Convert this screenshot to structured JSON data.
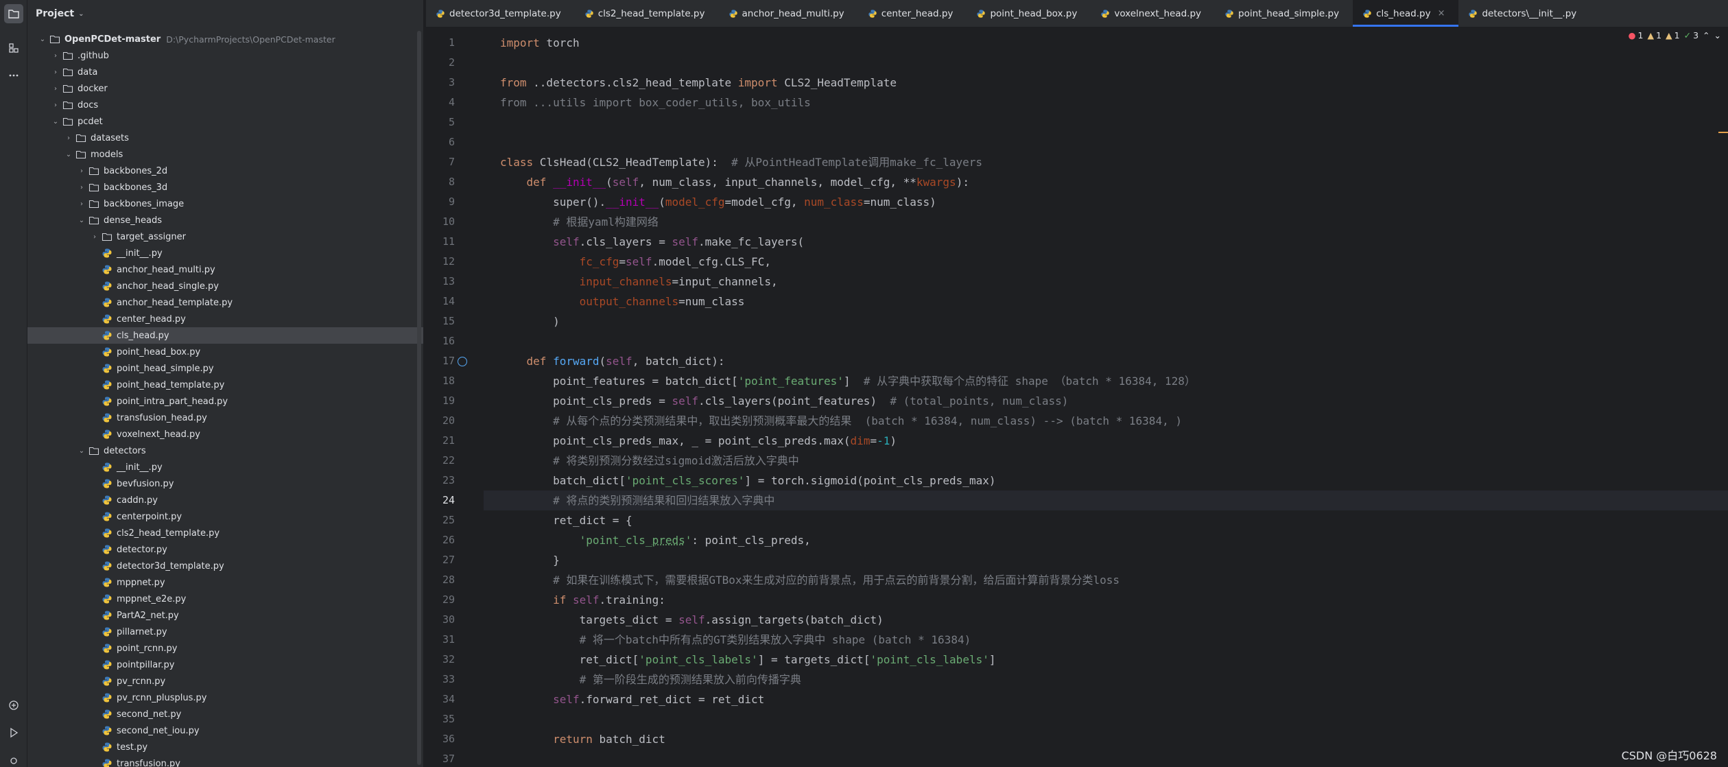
{
  "project": {
    "title": "Project",
    "root_name": "OpenPCDet-master",
    "root_path": "D:\\PycharmProjects\\OpenPCDet-master",
    "tree": [
      {
        "label": ".github",
        "type": "folder",
        "depth": 1,
        "state": "closed"
      },
      {
        "label": "data",
        "type": "folder",
        "depth": 1,
        "state": "closed"
      },
      {
        "label": "docker",
        "type": "folder",
        "depth": 1,
        "state": "closed"
      },
      {
        "label": "docs",
        "type": "folder",
        "depth": 1,
        "state": "closed"
      },
      {
        "label": "pcdet",
        "type": "folder",
        "depth": 1,
        "state": "open"
      },
      {
        "label": "datasets",
        "type": "folder",
        "depth": 2,
        "state": "closed"
      },
      {
        "label": "models",
        "type": "folder",
        "depth": 2,
        "state": "open"
      },
      {
        "label": "backbones_2d",
        "type": "folder",
        "depth": 3,
        "state": "closed"
      },
      {
        "label": "backbones_3d",
        "type": "folder",
        "depth": 3,
        "state": "closed"
      },
      {
        "label": "backbones_image",
        "type": "folder",
        "depth": 3,
        "state": "closed"
      },
      {
        "label": "dense_heads",
        "type": "folder",
        "depth": 3,
        "state": "open"
      },
      {
        "label": "target_assigner",
        "type": "folder",
        "depth": 4,
        "state": "closed"
      },
      {
        "label": "__init__.py",
        "type": "py",
        "depth": 4
      },
      {
        "label": "anchor_head_multi.py",
        "type": "py",
        "depth": 4
      },
      {
        "label": "anchor_head_single.py",
        "type": "py",
        "depth": 4
      },
      {
        "label": "anchor_head_template.py",
        "type": "py",
        "depth": 4
      },
      {
        "label": "center_head.py",
        "type": "py",
        "depth": 4
      },
      {
        "label": "cls_head.py",
        "type": "py",
        "depth": 4,
        "selected": true
      },
      {
        "label": "point_head_box.py",
        "type": "py",
        "depth": 4
      },
      {
        "label": "point_head_simple.py",
        "type": "py",
        "depth": 4
      },
      {
        "label": "point_head_template.py",
        "type": "py",
        "depth": 4
      },
      {
        "label": "point_intra_part_head.py",
        "type": "py",
        "depth": 4
      },
      {
        "label": "transfusion_head.py",
        "type": "py",
        "depth": 4
      },
      {
        "label": "voxelnext_head.py",
        "type": "py",
        "depth": 4
      },
      {
        "label": "detectors",
        "type": "folder",
        "depth": 3,
        "state": "open"
      },
      {
        "label": "__init__.py",
        "type": "py",
        "depth": 4
      },
      {
        "label": "bevfusion.py",
        "type": "py",
        "depth": 4
      },
      {
        "label": "caddn.py",
        "type": "py",
        "depth": 4
      },
      {
        "label": "centerpoint.py",
        "type": "py",
        "depth": 4
      },
      {
        "label": "cls2_head_template.py",
        "type": "py",
        "depth": 4
      },
      {
        "label": "detector.py",
        "type": "py",
        "depth": 4
      },
      {
        "label": "detector3d_template.py",
        "type": "py",
        "depth": 4
      },
      {
        "label": "mppnet.py",
        "type": "py",
        "depth": 4
      },
      {
        "label": "mppnet_e2e.py",
        "type": "py",
        "depth": 4
      },
      {
        "label": "PartA2_net.py",
        "type": "py",
        "depth": 4
      },
      {
        "label": "pillarnet.py",
        "type": "py",
        "depth": 4
      },
      {
        "label": "point_rcnn.py",
        "type": "py",
        "depth": 4
      },
      {
        "label": "pointpillar.py",
        "type": "py",
        "depth": 4
      },
      {
        "label": "pv_rcnn.py",
        "type": "py",
        "depth": 4
      },
      {
        "label": "pv_rcnn_plusplus.py",
        "type": "py",
        "depth": 4
      },
      {
        "label": "second_net.py",
        "type": "py",
        "depth": 4
      },
      {
        "label": "second_net_iou.py",
        "type": "py",
        "depth": 4
      },
      {
        "label": "test.py",
        "type": "py",
        "depth": 4
      },
      {
        "label": "transfusion.py",
        "type": "py",
        "depth": 4
      }
    ]
  },
  "tabs": [
    {
      "label": "detector3d_template.py"
    },
    {
      "label": "cls2_head_template.py"
    },
    {
      "label": "anchor_head_multi.py"
    },
    {
      "label": "center_head.py"
    },
    {
      "label": "point_head_box.py"
    },
    {
      "label": "voxelnext_head.py"
    },
    {
      "label": "point_head_simple.py"
    },
    {
      "label": "cls_head.py",
      "active": true
    },
    {
      "label": "detectors\\__init__.py"
    }
  ],
  "inspections": {
    "errors": "1",
    "warnings": "1",
    "weak_warnings": "1",
    "ok": "3"
  },
  "editor": {
    "current_line": 24,
    "lines": [
      "<span class=\"kw\">import</span> torch",
      "",
      "<span class=\"kw\">from</span> ..detectors.cls2_head_template <span class=\"kw\">import</span> CLS2_HeadTemplate",
      "<span class=\"dim\">from ...utils import box_coder_utils, box_utils</span>",
      "",
      "",
      "<span class=\"kw\">class</span> ClsHead(CLS2_HeadTemplate):  <span class=\"cmt\"># 从PointHeadTemplate调用make_fc_layers</span>",
      "    <span class=\"kw\">def</span> <span class=\"dund\">__init__</span>(<span class=\"self\">self</span>, num_class, input_channels, model_cfg, **<span class=\"param\">kwargs</span>):",
      "        super().<span class=\"dund\">__init__</span>(<span class=\"param\">model_cfg</span>=model_cfg, <span class=\"param\">num_class</span>=num_class)",
      "        <span class=\"cmt\"># 根据yaml构建网络</span>",
      "        <span class=\"self\">self</span>.cls_layers = <span class=\"self\">self</span>.make_fc_layers(",
      "            <span class=\"param\">fc_cfg</span>=<span class=\"self\">self</span>.model_cfg.CLS_FC,",
      "            <span class=\"param\">input_channels</span>=input_channels,",
      "            <span class=\"param\">output_channels</span>=num_class",
      "        )",
      "",
      "    <span class=\"kw\">def</span> <span class=\"fn\">forward</span>(<span class=\"self\">self</span>, batch_dict):",
      "        point_features = batch_dict[<span class=\"str\">'point_features'</span>]  <span class=\"cmt\"># 从字典中获取每个点的特征 shape （batch * 16384, 128）</span>",
      "        point_cls_preds = <span class=\"self\">self</span>.cls_layers(point_features)  <span class=\"cmt\"># (total_points, num_class)</span>",
      "        <span class=\"cmt\"># 从每个点的分类预测结果中，取出类别预测概率最大的结果  (batch * 16384, num_class) --> (batch * 16384, )</span>",
      "        point_cls_preds_max, _ = point_cls_preds.max(<span class=\"param\">dim</span>=<span class=\"num\">-1</span>)",
      "        <span class=\"cmt\"># 将类别预测分数经过sigmoid激活后放入字典中</span>",
      "        batch_dict[<span class=\"str\">'point_cls_scores'</span>] = torch.sigmoid(point_cls_preds_max)",
      "        <span class=\"cmt\"># 将点的类别预测结果和回归结果放入字典中</span>",
      "        ret_dict = {",
      "            <span class=\"str\">'point_cls_<span class=\"und\">preds</span>'</span>: point_cls_preds,",
      "        }",
      "        <span class=\"cmt\"># 如果在训练模式下，需要根据GTBox来生成对应的前背景点，用于点云的前背景分割，给后面计算前背景分类loss</span>",
      "        <span class=\"kw\">if</span> <span class=\"self\">self</span>.training:",
      "            targets_dict = <span class=\"self\">self</span>.assign_targets(batch_dict)",
      "            <span class=\"cmt\"># 将一个batch中所有点的GT类别结果放入字典中 shape (batch * 16384)</span>",
      "            ret_dict[<span class=\"str\">'point_cls_labels'</span>] = targets_dict[<span class=\"str\">'point_cls_labels'</span>]",
      "            <span class=\"cmt\"># 第一阶段生成的预测结果放入前向传播字典</span>",
      "        <span class=\"self\">self</span>.forward_ret_dict = ret_dict",
      "",
      "        <span class=\"kw\">return</span> batch_dict",
      ""
    ]
  },
  "watermark": "CSDN @白巧0628",
  "colors": {
    "accent": "#3574f0",
    "selection": "#43454a",
    "background": "#1e1f22",
    "panel": "#2b2d30"
  }
}
